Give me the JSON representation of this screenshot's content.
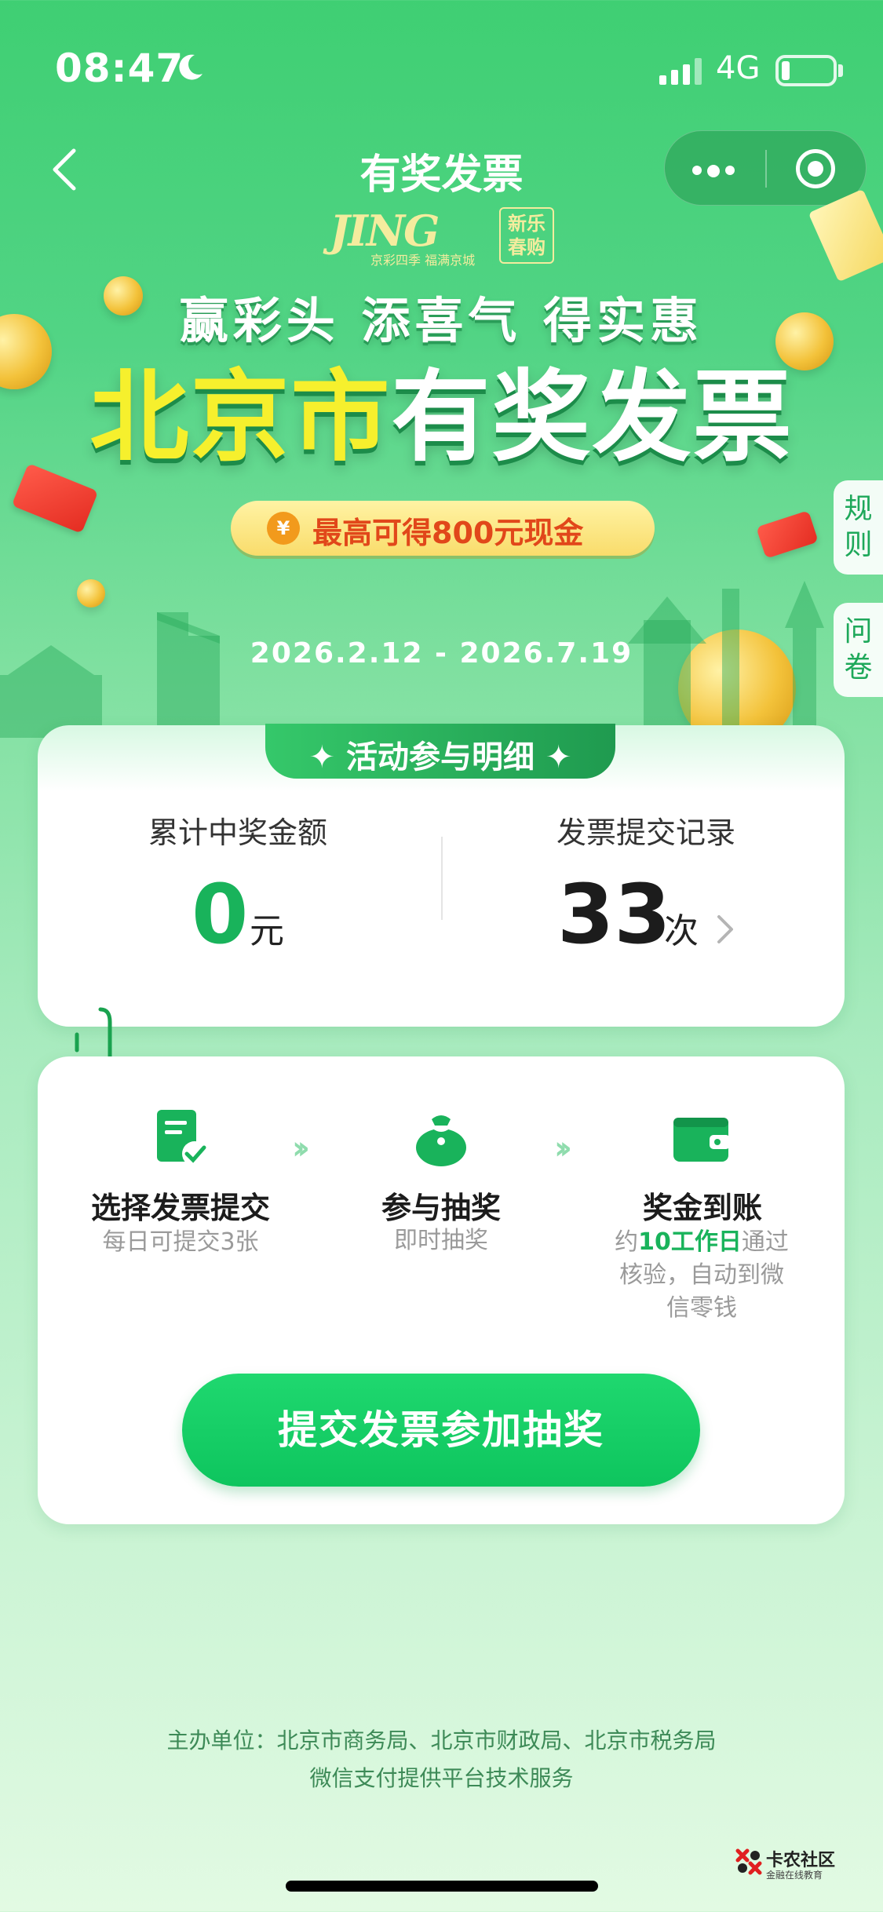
{
  "status_bar": {
    "time": "08:47",
    "network": "4G"
  },
  "nav": {
    "title": "有奖发票"
  },
  "banner": {
    "logo_text": "JING",
    "logo_subtitle": "京彩四季 福满京城",
    "seal_text_1": "新乐",
    "seal_text_2": "春购",
    "slogan": "赢彩头 添喜气 得实惠",
    "title_part1": "北京市",
    "title_part2": "有奖发票",
    "cash_symbol": "¥",
    "cash_text": "最高可得800元现金",
    "date_range": "2026.2.12 - 2026.7.19"
  },
  "side_tabs": {
    "rules": "规则",
    "survey": "问卷"
  },
  "participation": {
    "header": "✦ 活动参与明细 ✦",
    "prize_label": "累计中奖金额",
    "prize_value": "0",
    "prize_unit": "元",
    "record_label": "发票提交记录",
    "record_value": "33",
    "record_unit": "次"
  },
  "steps": [
    {
      "icon": "invoice-check-icon",
      "title": "选择发票提交",
      "sub": "每日可提交3张"
    },
    {
      "icon": "lucky-bag-icon",
      "title": "参与抽奖",
      "sub": "即时抽奖"
    },
    {
      "icon": "wallet-icon",
      "title": "奖金到账",
      "sub_prefix": "约",
      "sub_highlight": "10工作日",
      "sub_suffix_1": "通过",
      "sub_suffix_2": "核验，自动到微",
      "sub_suffix_3": "信零钱"
    }
  ],
  "submit_button": "提交发票参加抽奖",
  "footer": {
    "organizers": "主办单位：北京市商务局、北京市财政局、北京市税务局",
    "tech": "微信支付提供平台技术服务"
  },
  "watermark": {
    "name": "卡农社区",
    "sub": "金融在线教育"
  },
  "colors": {
    "primary_green": "#19b35b",
    "title_yellow": "#f6f02d",
    "cash_red": "#e1471a"
  }
}
